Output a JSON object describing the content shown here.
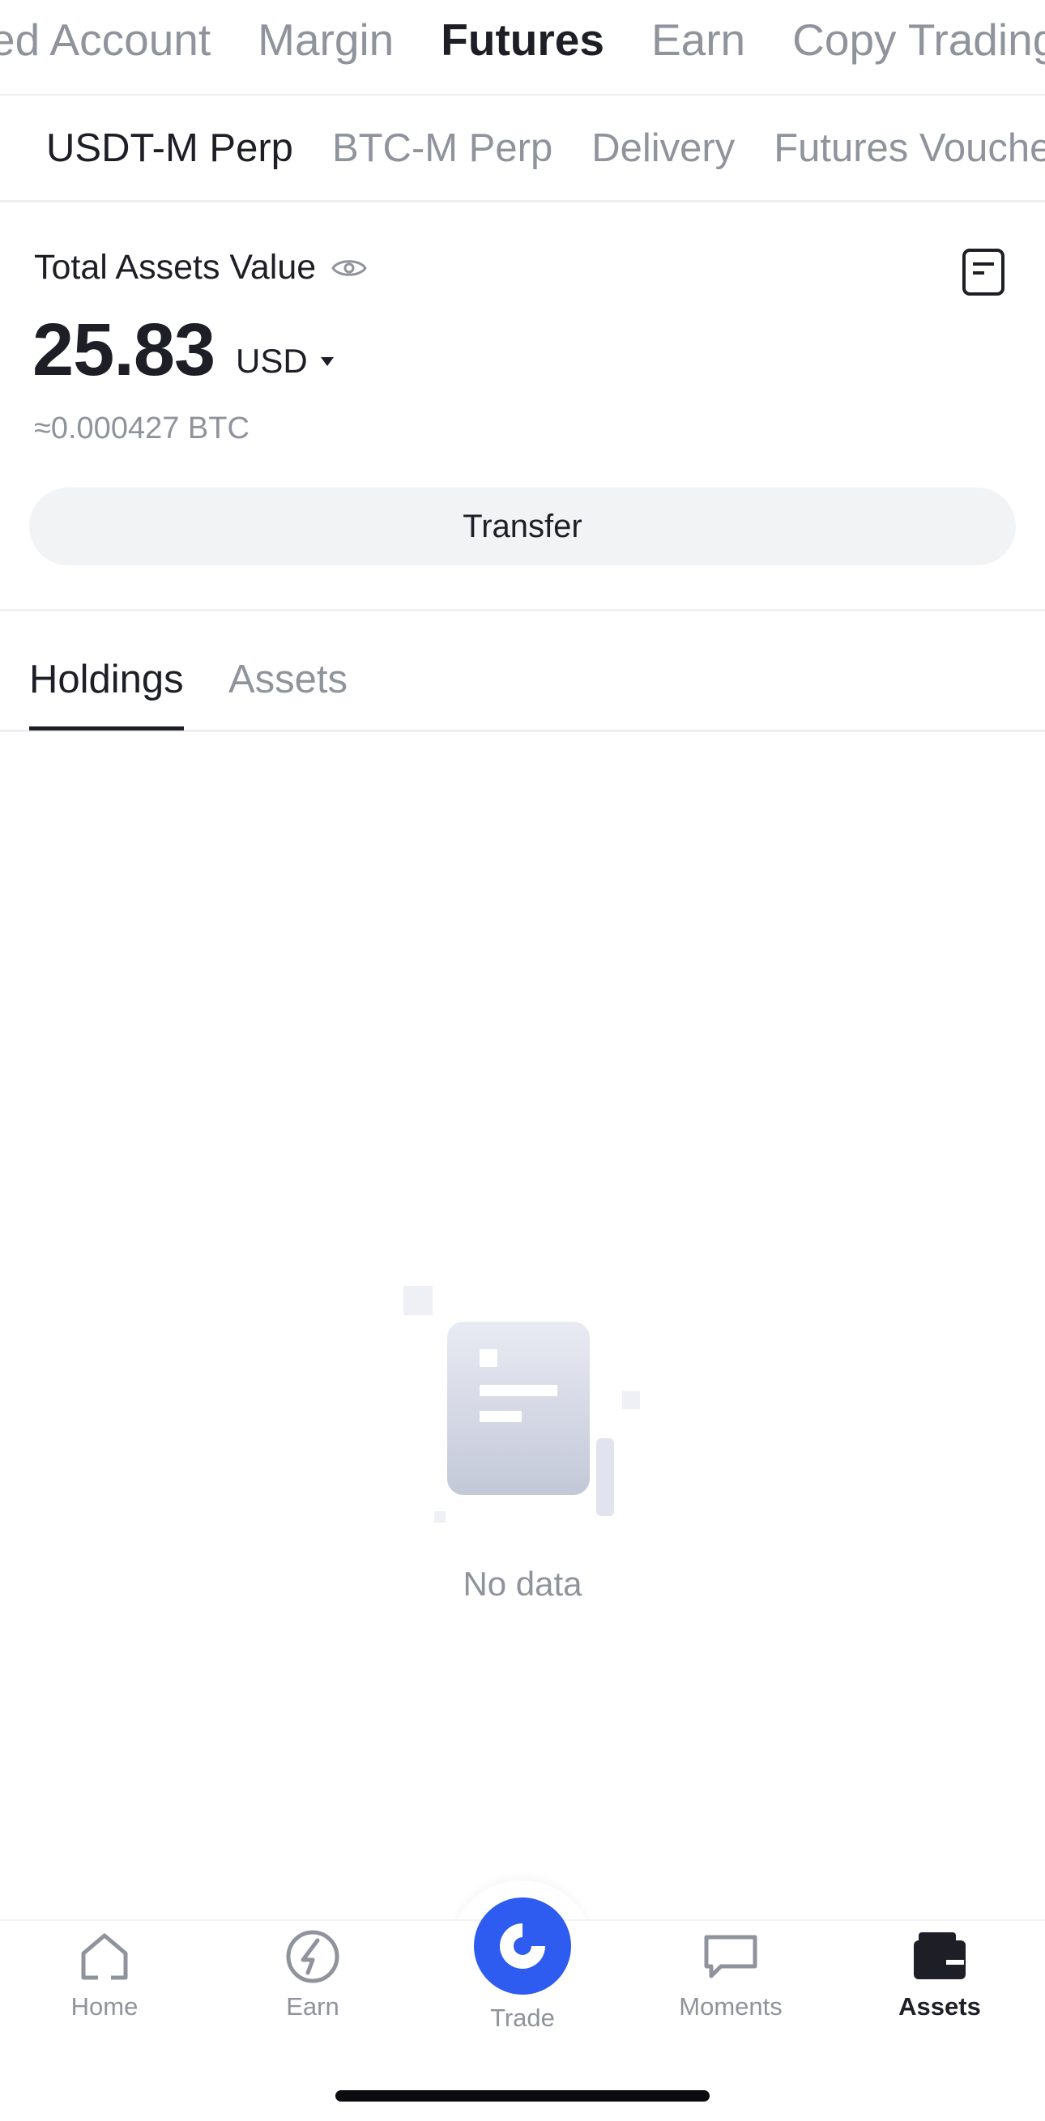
{
  "top_tabs": [
    "ed Account",
    "Margin",
    "Futures",
    "Earn",
    "Copy Trading"
  ],
  "top_tabs_active": "Futures",
  "sub_tabs": [
    "USDT-M Perp",
    "BTC-M Perp",
    "Delivery",
    "Futures Vouche"
  ],
  "summary": {
    "label": "Total Assets Value",
    "value": "25.83",
    "currency": "USD",
    "btc_approx": "≈0.000427 BTC",
    "transfer_label": "Transfer"
  },
  "content_tabs": {
    "holdings": "Holdings",
    "assets": "Assets"
  },
  "empty_state": {
    "text": "No data"
  },
  "bottom_nav": {
    "home": "Home",
    "earn": "Earn",
    "trade": "Trade",
    "moments": "Moments",
    "assets": "Assets"
  },
  "colors": {
    "accent": "#2e5bf0",
    "text_primary": "#1d1e26",
    "text_secondary": "#8f939c",
    "button_bg": "#f2f3f5"
  },
  "icons": {
    "eye": "eye-icon",
    "history": "document-icon",
    "home": "home-icon",
    "earn": "earn-icon",
    "trade": "trade-icon",
    "moments": "chat-icon",
    "assets": "wallet-icon"
  }
}
